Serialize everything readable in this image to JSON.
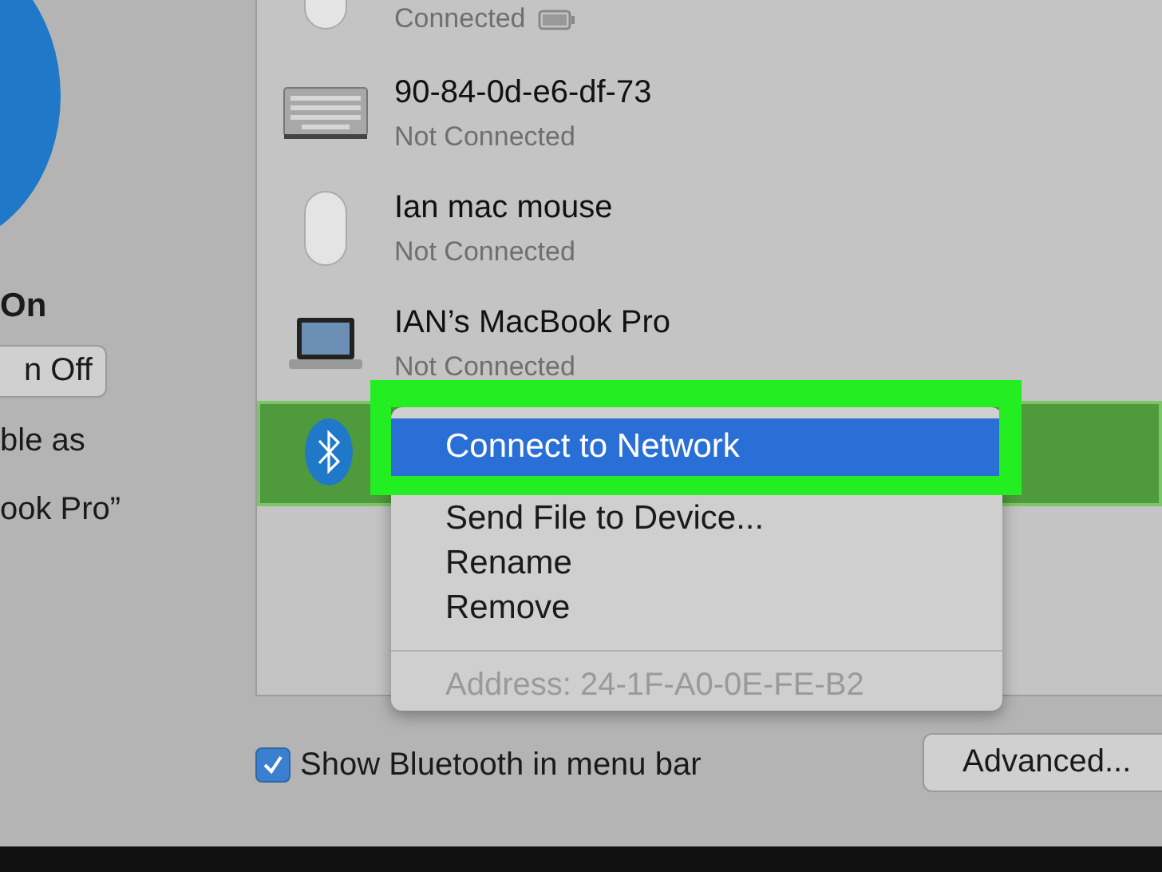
{
  "sidebar": {
    "status": "On",
    "toggle_button": "n Off",
    "caption_lines": [
      "ble as",
      "ook Pro”"
    ]
  },
  "devices": [
    {
      "kind": "mouse",
      "status": "Connected",
      "battery": true,
      "selected": false
    },
    {
      "kind": "keyboard",
      "name": "90-84-0d-e6-df-73",
      "status": "Not Connected",
      "battery": false,
      "selected": false
    },
    {
      "kind": "mouse",
      "name": "Ian mac mouse",
      "status": "Not Connected",
      "battery": false,
      "selected": false
    },
    {
      "kind": "laptop",
      "name": "IAN’s MacBook Pro",
      "status": "Not Connected",
      "battery": false,
      "selected": false
    },
    {
      "kind": "bluetooth",
      "selected": true
    }
  ],
  "context_menu": {
    "items": [
      {
        "label": "Connect to Network",
        "selected": true
      },
      {
        "label": "Send File to Device...",
        "selected": false
      },
      {
        "label": "Rename",
        "selected": false
      },
      {
        "label": "Remove",
        "selected": false
      }
    ],
    "address": "Address: 24-1F-A0-0E-FE-B2"
  },
  "show_in_menu_bar": {
    "label": "Show Bluetooth in menu bar",
    "checked": true
  },
  "advanced_button": "Advanced..."
}
